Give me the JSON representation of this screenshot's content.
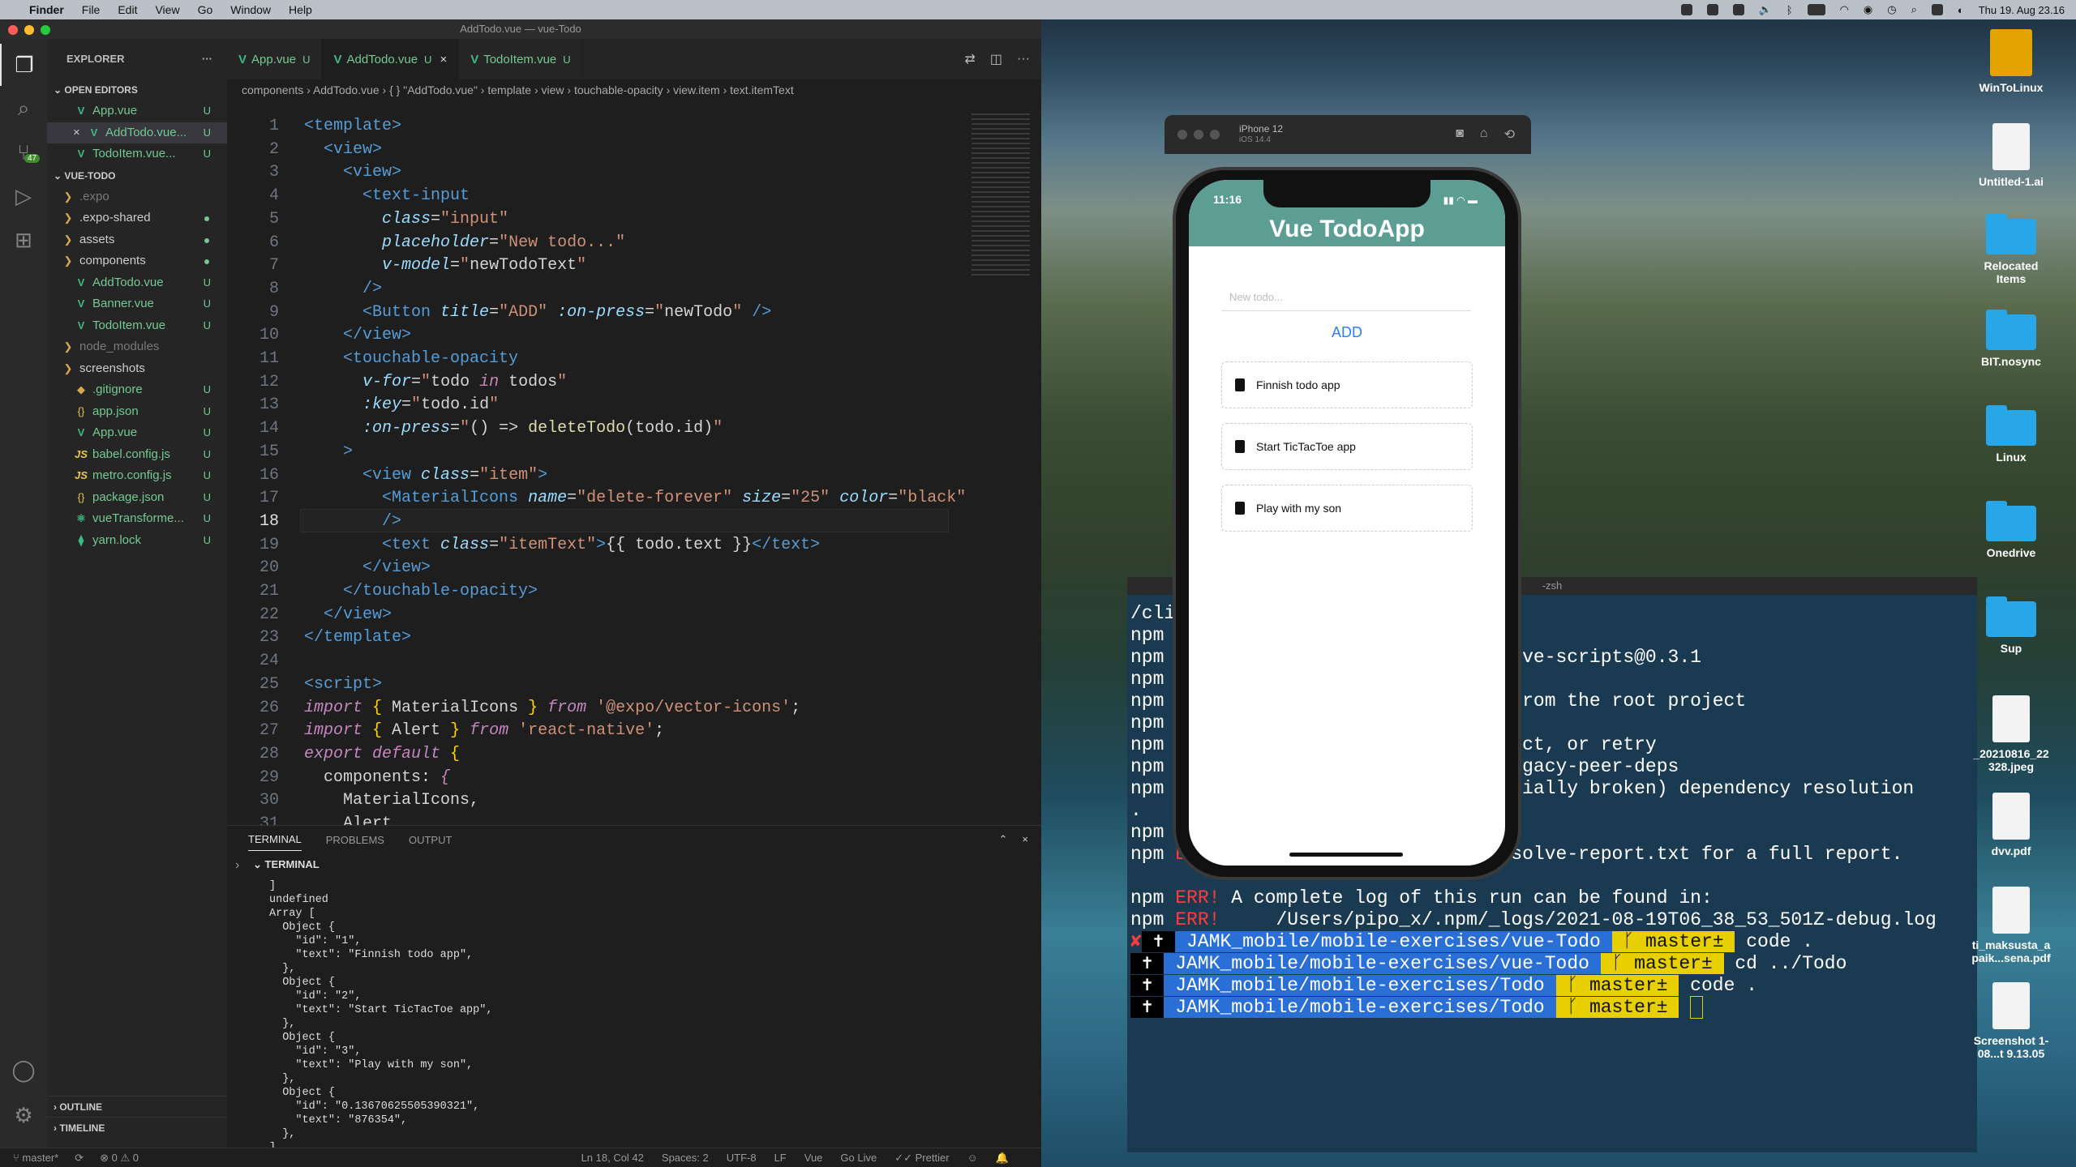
{
  "menubar": {
    "apple": "",
    "app": "Finder",
    "items": [
      "File",
      "Edit",
      "View",
      "Go",
      "Window",
      "Help"
    ],
    "datetime": "Thu 19. Aug  23.16"
  },
  "vscode": {
    "title": "AddTodo.vue — vue-Todo",
    "scm_badge": "47",
    "explorer_title": "EXPLORER",
    "open_editors_title": "OPEN EDITORS",
    "open_editors": [
      {
        "name": "App.vue",
        "status": "U"
      },
      {
        "name": "AddTodo.vue...",
        "status": "U"
      },
      {
        "name": "TodoItem.vue...",
        "status": "U"
      }
    ],
    "project_title": "VUE-TODO",
    "tree": [
      {
        "name": ".expo",
        "status": "",
        "gray": true,
        "type": "folder"
      },
      {
        "name": ".expo-shared",
        "status": "dot",
        "type": "folder"
      },
      {
        "name": "assets",
        "status": "dot",
        "type": "folder"
      },
      {
        "name": "components",
        "status": "dot",
        "type": "folder"
      },
      {
        "name": "AddTodo.vue",
        "status": "U",
        "type": "vue"
      },
      {
        "name": "Banner.vue",
        "status": "U",
        "type": "vue"
      },
      {
        "name": "TodoItem.vue",
        "status": "U",
        "type": "vue"
      },
      {
        "name": "node_modules",
        "status": "",
        "gray": true,
        "type": "folder"
      },
      {
        "name": "screenshots",
        "status": "",
        "type": "folder"
      },
      {
        "name": ".gitignore",
        "status": "U",
        "type": "git"
      },
      {
        "name": "app.json",
        "status": "U",
        "type": "json"
      },
      {
        "name": "App.vue",
        "status": "U",
        "type": "vue"
      },
      {
        "name": "babel.config.js",
        "status": "U",
        "type": "js"
      },
      {
        "name": "metro.config.js",
        "status": "U",
        "type": "js"
      },
      {
        "name": "package.json",
        "status": "U",
        "type": "json"
      },
      {
        "name": "vueTransforme...",
        "status": "U",
        "type": "react"
      },
      {
        "name": "yarn.lock",
        "status": "U",
        "type": "yarn"
      }
    ],
    "outline": "OUTLINE",
    "timeline": "TIMELINE",
    "tabs": [
      {
        "name": "App.vue",
        "status": "U"
      },
      {
        "name": "AddTodo.vue",
        "status": "U"
      },
      {
        "name": "TodoItem.vue",
        "status": "U"
      }
    ],
    "breadcrumbs": "components  ›  AddTodo.vue  ›  { } \"AddTodo.vue\"  ›  template  ›  view  ›  touchable-opacity  ›  view.item  ›  text.itemText",
    "panel_tabs": [
      "TERMINAL",
      "PROBLEMS",
      "OUTPUT"
    ],
    "terminal_title": "TERMINAL",
    "terminal_output": "]\nundefined\nArray [\n  Object {\n    \"id\": \"1\",\n    \"text\": \"Finnish todo app\",\n  },\n  Object {\n    \"id\": \"2\",\n    \"text\": \"Start TicTacToe app\",\n  },\n  Object {\n    \"id\": \"3\",\n    \"text\": \"Play with my son\",\n  },\n  Object {\n    \"id\": \"0.13670625505390321\",\n    \"text\": \"876354\",\n  },\n]",
    "status": {
      "branch": "master*",
      "problems": "⊗ 0 ⚠ 0",
      "position": "Ln 18, Col 42",
      "spaces": "Spaces: 2",
      "encoding": "UTF-8",
      "eol": "LF",
      "lang": "Vue",
      "golive": "Go Live",
      "prettier": "Prettier"
    }
  },
  "simulator": {
    "device": "iPhone 12",
    "os": "iOS 14.4",
    "time": "11:16",
    "app_title": "Vue TodoApp",
    "input_placeholder": "New todo...",
    "add_label": "ADD",
    "todos": [
      "Finnish todo app",
      "Start TicTacToe app",
      "Play with my son"
    ]
  },
  "iterm": {
    "title": "-zsh"
  },
  "desktop": [
    {
      "name": "WinToLinux",
      "kind": "drive"
    },
    {
      "name": "Untitled-1.ai",
      "kind": "doc"
    },
    {
      "name": "Relocated Items",
      "kind": "folder"
    },
    {
      "name": "BIT.nosync",
      "kind": "folder"
    },
    {
      "name": "Linux",
      "kind": "folder"
    },
    {
      "name": "Onedrive",
      "kind": "folder"
    },
    {
      "name": "Sup",
      "kind": "folder"
    },
    {
      "name": "_20210816_22 328.jpeg",
      "kind": "doc"
    },
    {
      "name": "dvv.pdf",
      "kind": "doc"
    },
    {
      "name": "ti_maksusta_a paik...sena.pdf",
      "kind": "doc"
    },
    {
      "name": "Screenshot 1-08...t 9.13.05",
      "kind": "doc"
    }
  ]
}
